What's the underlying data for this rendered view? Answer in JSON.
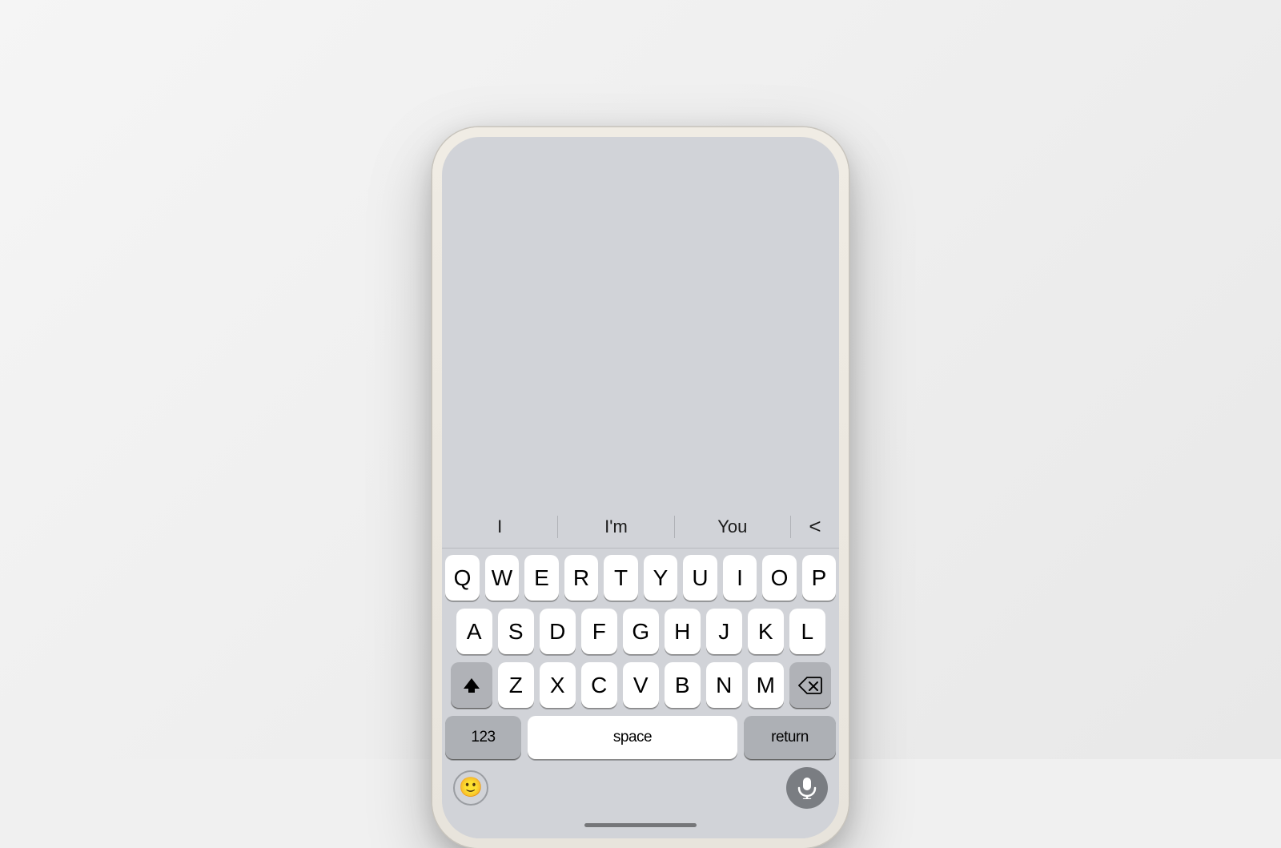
{
  "scene": {
    "background": "#efefef"
  },
  "predictive": {
    "word1": "I",
    "word2": "I'm",
    "word3": "You",
    "back_icon": "<"
  },
  "keyboard": {
    "row1": [
      "Q",
      "W",
      "E",
      "R",
      "T",
      "Y",
      "U",
      "I",
      "O",
      "P"
    ],
    "row2": [
      "A",
      "S",
      "D",
      "F",
      "G",
      "H",
      "J",
      "K",
      "L"
    ],
    "row3": [
      "Z",
      "X",
      "C",
      "V",
      "B",
      "N",
      "M"
    ],
    "bottom": {
      "numbers_label": "123",
      "space_label": "space",
      "return_label": "return"
    }
  },
  "footer": {
    "emoji_label": "😀",
    "home_indicator": true
  }
}
